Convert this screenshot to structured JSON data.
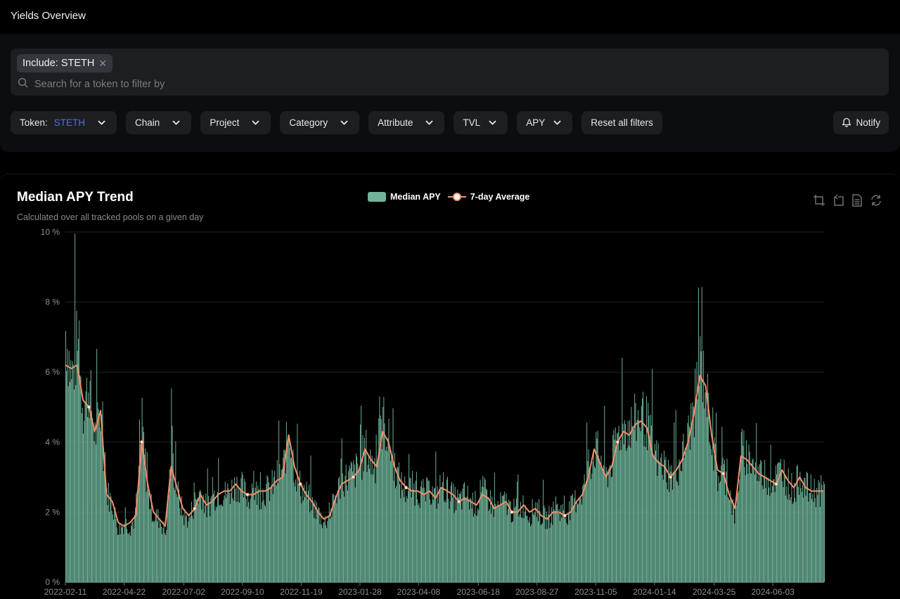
{
  "header": {
    "title": "Yields Overview"
  },
  "filters": {
    "chip": {
      "label": "Include: STETH",
      "remove_icon": "close-icon"
    },
    "search": {
      "placeholder": "Search for a token to filter by",
      "value": "",
      "icon": "search-icon"
    },
    "buttons": [
      {
        "label": "Token:",
        "value": "STETH",
        "icon": "chevron-down-icon"
      },
      {
        "label": "Chain",
        "icon": "chevron-down-icon"
      },
      {
        "label": "Project",
        "icon": "chevron-down-icon"
      },
      {
        "label": "Category",
        "icon": "chevron-down-icon"
      },
      {
        "label": "Attribute",
        "icon": "chevron-down-icon"
      },
      {
        "label": "TVL",
        "icon": "chevron-down-icon"
      },
      {
        "label": "APY",
        "icon": "chevron-down-icon"
      }
    ],
    "reset_label": "Reset all filters",
    "notify_label": "Notify",
    "notify_icon": "bell-icon"
  },
  "colors": {
    "bar": "#6fb49a",
    "line": "#f0906a",
    "accent_blue": "#4f6fd6",
    "grid": "#222222"
  },
  "chart_tools": [
    "zoom-icon",
    "zoom-reset-icon",
    "data-view-icon",
    "restore-icon"
  ],
  "chart_data": {
    "type": "bar",
    "title": "Median APY Trend",
    "subtitle": "Calculated over all tracked pools on a given day",
    "legend": [
      "Median APY",
      "7-day Average"
    ],
    "legend_position": "top-center",
    "xlabel": "",
    "ylabel": "",
    "ylim": [
      0,
      10
    ],
    "y_ticks": [
      "0 %",
      "2 %",
      "4 %",
      "6 %",
      "8 %",
      "10 %"
    ],
    "x_tick_labels": [
      "2022-02-11",
      "2022-04-22",
      "2022-07-02",
      "2022-09-10",
      "2022-11-19",
      "2023-01-28",
      "2023-04-08",
      "2023-06-18",
      "2023-08-27",
      "2023-11-05",
      "2024-01-14",
      "2024-03-25",
      "2024-06-03"
    ],
    "x_range": [
      "2022-02-11",
      "2024-08-03"
    ],
    "grid": true,
    "series": [
      {
        "name": "Median APY",
        "type": "bar",
        "note": "daily values, sampled approx. every 7 days",
        "dates": [
          "2022-02-11",
          "2022-02-18",
          "2022-02-25",
          "2022-03-04",
          "2022-03-11",
          "2022-03-18",
          "2022-03-25",
          "2022-04-01",
          "2022-04-08",
          "2022-04-15",
          "2022-04-22",
          "2022-04-29",
          "2022-05-06",
          "2022-05-13",
          "2022-05-20",
          "2022-05-27",
          "2022-06-03",
          "2022-06-10",
          "2022-06-17",
          "2022-06-24",
          "2022-07-01",
          "2022-07-08",
          "2022-07-15",
          "2022-07-22",
          "2022-07-29",
          "2022-08-05",
          "2022-08-12",
          "2022-08-19",
          "2022-08-26",
          "2022-09-02",
          "2022-09-09",
          "2022-09-16",
          "2022-09-23",
          "2022-09-30",
          "2022-10-07",
          "2022-10-14",
          "2022-10-21",
          "2022-10-28",
          "2022-11-04",
          "2022-11-11",
          "2022-11-18",
          "2022-11-25",
          "2022-12-02",
          "2022-12-09",
          "2022-12-16",
          "2022-12-23",
          "2022-12-30",
          "2023-01-06",
          "2023-01-13",
          "2023-01-20",
          "2023-01-27",
          "2023-02-03",
          "2023-02-10",
          "2023-02-17",
          "2023-02-24",
          "2023-03-03",
          "2023-03-10",
          "2023-03-17",
          "2023-03-24",
          "2023-03-31",
          "2023-04-07",
          "2023-04-14",
          "2023-04-21",
          "2023-04-28",
          "2023-05-05",
          "2023-05-12",
          "2023-05-19",
          "2023-05-26",
          "2023-06-02",
          "2023-06-09",
          "2023-06-16",
          "2023-06-23",
          "2023-06-30",
          "2023-07-07",
          "2023-07-14",
          "2023-07-21",
          "2023-07-28",
          "2023-08-04",
          "2023-08-11",
          "2023-08-18",
          "2023-08-25",
          "2023-09-01",
          "2023-09-08",
          "2023-09-15",
          "2023-09-22",
          "2023-09-29",
          "2023-10-06",
          "2023-10-13",
          "2023-10-20",
          "2023-10-27",
          "2023-11-03",
          "2023-11-10",
          "2023-11-17",
          "2023-11-24",
          "2023-12-01",
          "2023-12-08",
          "2023-12-15",
          "2023-12-22",
          "2023-12-29",
          "2024-01-05",
          "2024-01-12",
          "2024-01-19",
          "2024-01-26",
          "2024-02-02",
          "2024-02-09",
          "2024-02-16",
          "2024-02-23",
          "2024-03-01",
          "2024-03-08",
          "2024-03-15",
          "2024-03-22",
          "2024-03-29",
          "2024-04-05",
          "2024-04-12",
          "2024-04-19",
          "2024-04-26",
          "2024-05-03",
          "2024-05-10",
          "2024-05-17",
          "2024-05-24",
          "2024-05-31",
          "2024-06-07",
          "2024-06-14",
          "2024-06-21",
          "2024-06-28",
          "2024-07-05",
          "2024-07-12",
          "2024-07-19",
          "2024-07-26",
          "2024-08-02"
        ],
        "values": [
          7.2,
          5.8,
          6.8,
          5.0,
          5.6,
          4.2,
          4.8,
          2.6,
          2.2,
          1.5,
          1.7,
          1.6,
          1.9,
          4.5,
          2.5,
          1.9,
          1.8,
          1.4,
          3.6,
          2.6,
          1.9,
          1.8,
          2.3,
          2.6,
          2.1,
          2.4,
          2.6,
          2.5,
          2.6,
          2.8,
          2.7,
          2.4,
          2.6,
          2.5,
          2.6,
          2.7,
          3.0,
          3.2,
          4.4,
          3.2,
          2.7,
          2.5,
          2.2,
          2.0,
          1.7,
          1.9,
          2.5,
          2.9,
          3.0,
          3.1,
          3.3,
          3.8,
          3.4,
          3.4,
          4.7,
          4.0,
          3.3,
          2.8,
          2.6,
          2.7,
          2.6,
          2.5,
          2.6,
          2.4,
          2.8,
          2.6,
          2.4,
          2.3,
          2.5,
          2.3,
          2.2,
          2.6,
          2.4,
          2.1,
          2.2,
          2.3,
          2.0,
          2.1,
          2.2,
          1.9,
          2.2,
          1.9,
          1.8,
          2.0,
          2.1,
          1.9,
          2.1,
          2.4,
          2.6,
          3.2,
          3.8,
          3.6,
          3.0,
          3.5,
          4.2,
          4.5,
          4.4,
          4.6,
          4.8,
          4.5,
          3.8,
          3.4,
          3.3,
          3.0,
          3.2,
          3.6,
          4.2,
          5.0,
          6.2,
          5.6,
          4.0,
          3.0,
          3.2,
          2.6,
          1.8,
          3.8,
          3.6,
          3.4,
          3.0,
          3.1,
          2.9,
          3.0,
          3.3,
          2.8,
          2.6,
          3.1,
          2.7,
          2.6,
          2.6,
          2.6
        ]
      },
      {
        "name": "7-day Average",
        "type": "line",
        "values": [
          6.2,
          6.1,
          6.2,
          5.2,
          5.0,
          4.3,
          4.9,
          2.5,
          2.3,
          1.7,
          1.6,
          1.7,
          1.9,
          4.0,
          2.8,
          2.0,
          1.8,
          1.6,
          3.3,
          2.7,
          2.1,
          1.9,
          2.1,
          2.5,
          2.2,
          2.3,
          2.5,
          2.6,
          2.6,
          2.8,
          2.6,
          2.5,
          2.5,
          2.6,
          2.6,
          2.7,
          2.9,
          3.0,
          4.2,
          3.3,
          2.8,
          2.5,
          2.3,
          2.0,
          1.8,
          1.9,
          2.4,
          2.8,
          2.9,
          3.0,
          3.2,
          3.8,
          3.5,
          3.3,
          4.3,
          4.0,
          3.3,
          2.9,
          2.7,
          2.6,
          2.6,
          2.5,
          2.6,
          2.4,
          2.7,
          2.6,
          2.5,
          2.3,
          2.4,
          2.3,
          2.2,
          2.5,
          2.4,
          2.1,
          2.2,
          2.3,
          2.0,
          2.0,
          2.2,
          2.0,
          2.1,
          1.9,
          1.8,
          2.0,
          2.0,
          1.9,
          2.0,
          2.3,
          2.5,
          3.0,
          3.8,
          3.4,
          3.0,
          3.3,
          4.0,
          4.3,
          4.2,
          4.5,
          4.6,
          4.4,
          3.6,
          3.4,
          3.3,
          3.0,
          3.2,
          3.5,
          4.0,
          4.8,
          5.9,
          5.6,
          4.2,
          3.2,
          3.1,
          2.5,
          2.1,
          3.6,
          3.5,
          3.3,
          3.1,
          3.0,
          2.9,
          2.8,
          3.2,
          2.9,
          2.7,
          3.0,
          2.7,
          2.6,
          2.6,
          2.6
        ]
      }
    ]
  }
}
